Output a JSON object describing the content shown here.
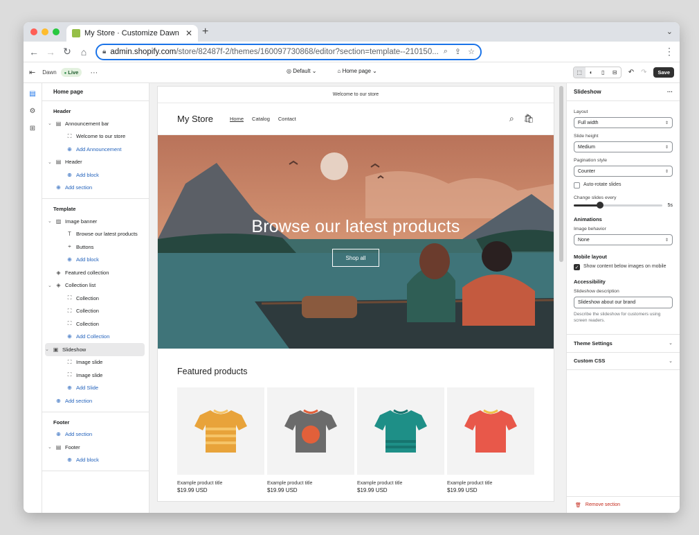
{
  "browser": {
    "tab_title": "My Store · Customize Dawn · S",
    "tab_close": "✕",
    "new_tab": "+",
    "url_host": "admin.shopify.com",
    "url_path": "/store/82487f-2/themes/160097730868/editor?section=template--210150...",
    "menu": "⋮"
  },
  "editor": {
    "theme_name": "Dawn",
    "live_badge": "Live",
    "more": "···",
    "template_select": "Default",
    "page_select": "Home page",
    "save_label": "Save"
  },
  "sidebar": {
    "title": "Home page",
    "groups": [
      {
        "title": "Header",
        "items": [
          {
            "label": "Announcement bar",
            "depth": 1,
            "chevron": true,
            "icon": "▤",
            "add": false
          },
          {
            "label": "Welcome to our store",
            "depth": 2,
            "chevron": false,
            "icon": "⛶",
            "add": false
          },
          {
            "label": "Add Announcement",
            "depth": 2,
            "chevron": false,
            "icon": "⊕",
            "add": true
          },
          {
            "label": "Header",
            "depth": 1,
            "chevron": true,
            "icon": "▤",
            "add": false
          },
          {
            "label": "Add block",
            "depth": 2,
            "chevron": false,
            "icon": "⊕",
            "add": true
          },
          {
            "label": "Add section",
            "depth": 1,
            "chevron": false,
            "icon": "⊕",
            "add": true
          }
        ]
      },
      {
        "title": "Template",
        "items": [
          {
            "label": "Image banner",
            "depth": 1,
            "chevron": true,
            "icon": "▨",
            "add": false
          },
          {
            "label": "Browse our latest products",
            "depth": 2,
            "chevron": false,
            "icon": "T",
            "add": false
          },
          {
            "label": "Buttons",
            "depth": 2,
            "chevron": false,
            "icon": "⌖",
            "add": false
          },
          {
            "label": "Add block",
            "depth": 2,
            "chevron": false,
            "icon": "⊕",
            "add": true
          },
          {
            "label": "Featured collection",
            "depth": 1,
            "chevron": false,
            "icon": "◈",
            "add": false
          },
          {
            "label": "Collection list",
            "depth": 1,
            "chevron": true,
            "icon": "◈",
            "add": false
          },
          {
            "label": "Collection",
            "depth": 2,
            "chevron": false,
            "icon": "⛶",
            "add": false
          },
          {
            "label": "Collection",
            "depth": 2,
            "chevron": false,
            "icon": "⛶",
            "add": false
          },
          {
            "label": "Collection",
            "depth": 2,
            "chevron": false,
            "icon": "⛶",
            "add": false
          },
          {
            "label": "Add Collection",
            "depth": 2,
            "chevron": false,
            "icon": "⊕",
            "add": true
          },
          {
            "label": "Slideshow",
            "depth": 1,
            "chevron": true,
            "icon": "▣",
            "add": false,
            "selected": true
          },
          {
            "label": "Image slide",
            "depth": 2,
            "chevron": false,
            "icon": "⛶",
            "add": false
          },
          {
            "label": "Image slide",
            "depth": 2,
            "chevron": false,
            "icon": "⛶",
            "add": false
          },
          {
            "label": "Add Slide",
            "depth": 2,
            "chevron": false,
            "icon": "⊕",
            "add": true
          },
          {
            "label": "Add section",
            "depth": 1,
            "chevron": false,
            "icon": "⊕",
            "add": true
          }
        ]
      },
      {
        "title": "Footer",
        "items": [
          {
            "label": "Add section",
            "depth": 1,
            "chevron": false,
            "icon": "⊕",
            "add": true
          },
          {
            "label": "Footer",
            "depth": 1,
            "chevron": true,
            "icon": "▤",
            "add": false
          },
          {
            "label": "Add block",
            "depth": 2,
            "chevron": false,
            "icon": "⊕",
            "add": true
          }
        ]
      }
    ]
  },
  "store": {
    "announcement": "Welcome to our store",
    "name": "My Store",
    "nav": [
      "Home",
      "Catalog",
      "Contact"
    ],
    "hero_title": "Browse our latest products",
    "hero_button": "Shop all",
    "featured_title": "Featured products",
    "products": [
      {
        "title": "Example product title",
        "price": "$19.99 USD",
        "color": "#e8a33a",
        "stripe": "#f5c468"
      },
      {
        "title": "Example product title",
        "price": "$19.99 USD",
        "color": "#6b6b6b",
        "stripe": "#e2603a"
      },
      {
        "title": "Example product title",
        "price": "$19.99 USD",
        "color": "#1e8f87",
        "stripe": "#16756f"
      },
      {
        "title": "Example product title",
        "price": "$19.99 USD",
        "color": "#e8584a",
        "stripe": "#f0c24a"
      }
    ]
  },
  "settings": {
    "title": "Slideshow",
    "more": "···",
    "layout_label": "Layout",
    "layout_value": "Full width",
    "slide_height_label": "Slide height",
    "slide_height_value": "Medium",
    "pagination_label": "Pagination style",
    "pagination_value": "Counter",
    "autorotate_label": "Auto-rotate slides",
    "autorotate_checked": false,
    "change_every_label": "Change slides every",
    "change_every_value": "5s",
    "change_every_fraction": 0.3,
    "animations_heading": "Animations",
    "image_behavior_label": "Image behavior",
    "image_behavior_value": "None",
    "mobile_heading": "Mobile layout",
    "mobile_check_label": "Show content below images on mobile",
    "mobile_checked": true,
    "accessibility_heading": "Accessibility",
    "slideshow_desc_label": "Slideshow description",
    "slideshow_desc_value": "Slideshow about our brand",
    "slideshow_desc_help": "Describe the slideshow for customers using screen readers.",
    "theme_settings": "Theme Settings",
    "custom_css": "Custom CSS",
    "remove_section": "Remove section"
  }
}
